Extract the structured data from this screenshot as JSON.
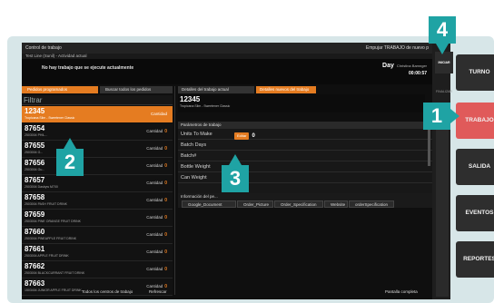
{
  "window": {
    "title": "Control de trabajo",
    "right_title": "Empujar TRABAJO de nuevo p",
    "line": "Test Line (Sunil) - Actividad actual"
  },
  "notice": {
    "message": "No hay trabajo que se ejecute actualmente",
    "day_label": "Day",
    "user": "Christina Bamnger",
    "time": "00:00:57"
  },
  "left_tabs": {
    "programmed": "Pedidos programados",
    "search_all": "Buscar todos los pedidos"
  },
  "filter_label": "Filtrar",
  "selected_order": {
    "number": "12345",
    "desc": "Tropicana Slim - Sweetener Classic",
    "qty_label": "Cantidad"
  },
  "orders": [
    {
      "number": "87654",
      "desc": "2503004 PHIL...",
      "qty_label": "Cantidad",
      "qty": "0"
    },
    {
      "number": "87655",
      "desc": "2503004 G...",
      "qty_label": "Cantidad",
      "qty": "0"
    },
    {
      "number": "87656",
      "desc": "2503004 Gu...",
      "qty_label": "Cantidad",
      "qty": "0"
    },
    {
      "number": "87657",
      "desc": "2503004 Dasbyw M700",
      "qty_label": "Cantidad",
      "qty": "0"
    },
    {
      "number": "87658",
      "desc": "2503004 PASH FRUIT DRINK",
      "qty_label": "Cantidad",
      "qty": "0"
    },
    {
      "number": "87659",
      "desc": "2503004 PINE ORANGE FRUIT DRINK",
      "qty_label": "Cantidad",
      "qty": "0"
    },
    {
      "number": "87660",
      "desc": "2503004 PINEAPPLE FRUIT DRINK",
      "qty_label": "Cantidad",
      "qty": "0"
    },
    {
      "number": "87661",
      "desc": "2503004 APPLE FRUIT DRINK",
      "qty_label": "Cantidad",
      "qty": "0"
    },
    {
      "number": "87662",
      "desc": "2503004 BLACKCURRANT FRUIT DRINK",
      "qty_label": "Cantidad",
      "qty": "0"
    },
    {
      "number": "87663",
      "desc": "1503404 JUNIOR APPLE FRUIT DRINK",
      "qty_label": "Cantidad",
      "qty": "0"
    }
  ],
  "left_footer": {
    "all_centers": "Todos los centros de trabajo",
    "refresh": "Refrescar"
  },
  "right_tabs": {
    "current_details": "Detalles del trabajo actual",
    "new_details": "Detalles nuevos del trabajo"
  },
  "order_header": {
    "number": "12345",
    "desc": "Tropicana Slim - Sweetener Classic"
  },
  "params": {
    "heading": "Parámetros de trabajo",
    "rows": [
      "Units To Make",
      "Batch Days",
      "Batch#",
      "Bottle Weight",
      "Can Weight"
    ],
    "edit_label": "Editar",
    "units_value": "0"
  },
  "info": {
    "heading": "Información del pe...",
    "tabs": [
      "Google_Document",
      "Order_Picture",
      "Order_Specification",
      "Website",
      "orderSpecification"
    ]
  },
  "right_footer": "Pantalla completa",
  "sidebar": {
    "start": "INICIAR",
    "finish": "FINALIZAR"
  },
  "actions": [
    "TURNO",
    "TRABAJO",
    "SALIDA",
    "EVENTOS",
    "REPORTES"
  ],
  "badges": [
    "1",
    "2",
    "3",
    "4"
  ]
}
